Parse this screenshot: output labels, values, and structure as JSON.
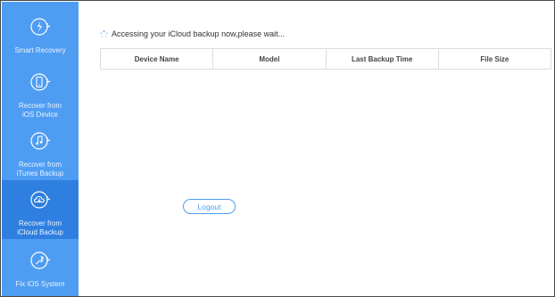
{
  "sidebar": {
    "items": [
      {
        "label": "Smart Recovery",
        "icon": "smart-recovery-icon",
        "active": false
      },
      {
        "label": "Recover from\niOS Device",
        "icon": "phone-icon",
        "active": false
      },
      {
        "label": "Recover from\niTunes Backup",
        "icon": "music-note-icon",
        "active": false
      },
      {
        "label": "Recover from\niCloud Backup",
        "icon": "cloud-icon",
        "active": true
      },
      {
        "label": "Fix iOS System",
        "icon": "wrench-icon",
        "active": false
      }
    ]
  },
  "main": {
    "status_text": "Accessing your iCloud backup now,please wait...",
    "table": {
      "columns": [
        "Device Name",
        "Model",
        "Last Backup Time",
        "File Size"
      ]
    },
    "logout_label": "Logout"
  },
  "colors": {
    "sidebar_bg": "#4f9df3",
    "sidebar_active": "#2f7fe0",
    "accent": "#4f9df3"
  }
}
